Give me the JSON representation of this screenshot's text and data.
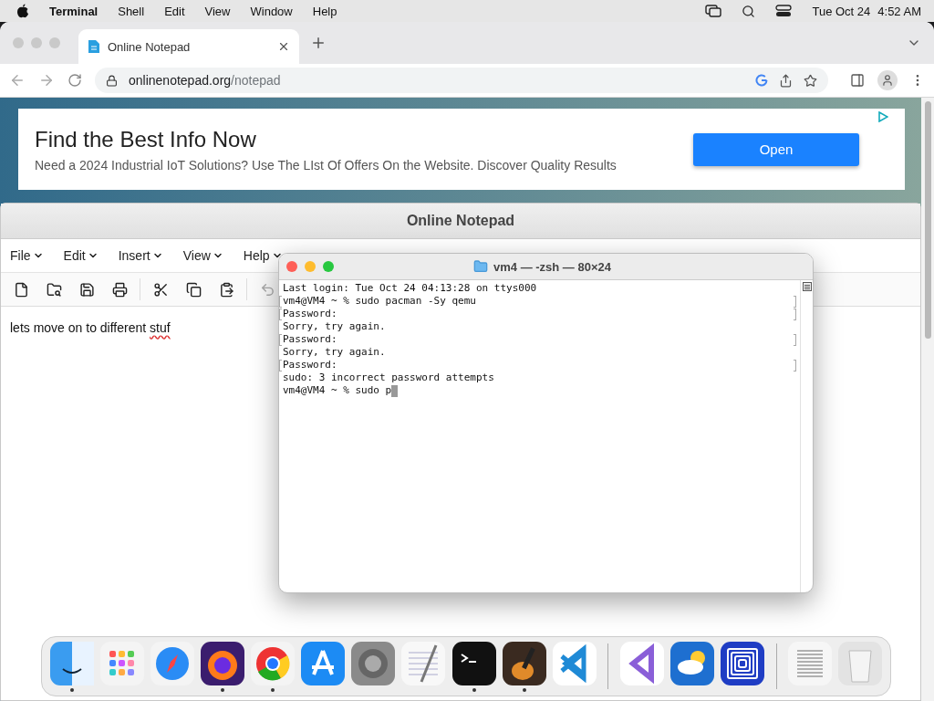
{
  "menu_bar": {
    "app": "Terminal",
    "menus": [
      "Shell",
      "Edit",
      "View",
      "Window",
      "Help"
    ],
    "date": "Tue Oct 24",
    "time": "4:52 AM"
  },
  "browser": {
    "tab": {
      "title": "Online Notepad"
    },
    "url": {
      "host": "onlinenotepad.org",
      "path": "/notepad"
    }
  },
  "ad": {
    "title": "Find the Best Info Now",
    "body": "Need a 2024 Industrial IoT Solutions? Use The LIst Of Offers On the Website. Discover Quality Results",
    "button": "Open"
  },
  "notepad": {
    "title": "Online Notepad",
    "menus": [
      "File",
      "Edit",
      "Insert",
      "View",
      "Help"
    ],
    "toolbar": [
      {
        "disabled": false
      },
      {
        "disabled": false
      },
      {
        "disabled": false
      },
      {
        "disabled": false
      },
      {
        "disabled": false
      },
      {
        "disabled": false
      },
      {
        "disabled": false
      },
      {
        "disabled": true
      }
    ],
    "text": "lets move on to different",
    "misspelled": "stuf"
  },
  "terminal": {
    "title": "vm4 — -zsh — 80×24",
    "cursor": true,
    "lines": [
      {
        "text": "Last login: Tue Oct 24 04:13:28 on ttys000",
        "marked": false
      },
      {
        "text": "vm4@VM4 ~ % sudo pacman -Sy qemu",
        "marked": true
      },
      {
        "text": "Password:",
        "marked": true
      },
      {
        "text": "Sorry, try again.",
        "marked": false
      },
      {
        "text": "Password:",
        "marked": true
      },
      {
        "text": "Sorry, try again.",
        "marked": false
      },
      {
        "text": "Password:",
        "marked": true
      },
      {
        "text": "sudo: 3 incorrect password attempts",
        "marked": false
      },
      {
        "text": "vm4@VM4 ~ % sudo p",
        "marked": false
      }
    ]
  },
  "dock": {
    "groups": [
      [
        {
          "running": true
        },
        {
          "running": false
        },
        {
          "running": false
        },
        {
          "running": true
        },
        {
          "running": true
        },
        {
          "running": false
        },
        {
          "running": false
        },
        {
          "running": false
        },
        {
          "running": true
        },
        {
          "running": true
        },
        {
          "running": false
        }
      ],
      [
        {
          "running": false
        },
        {
          "running": false
        },
        {
          "running": false
        }
      ],
      [
        {
          "running": false
        },
        {
          "running": false
        }
      ]
    ]
  }
}
